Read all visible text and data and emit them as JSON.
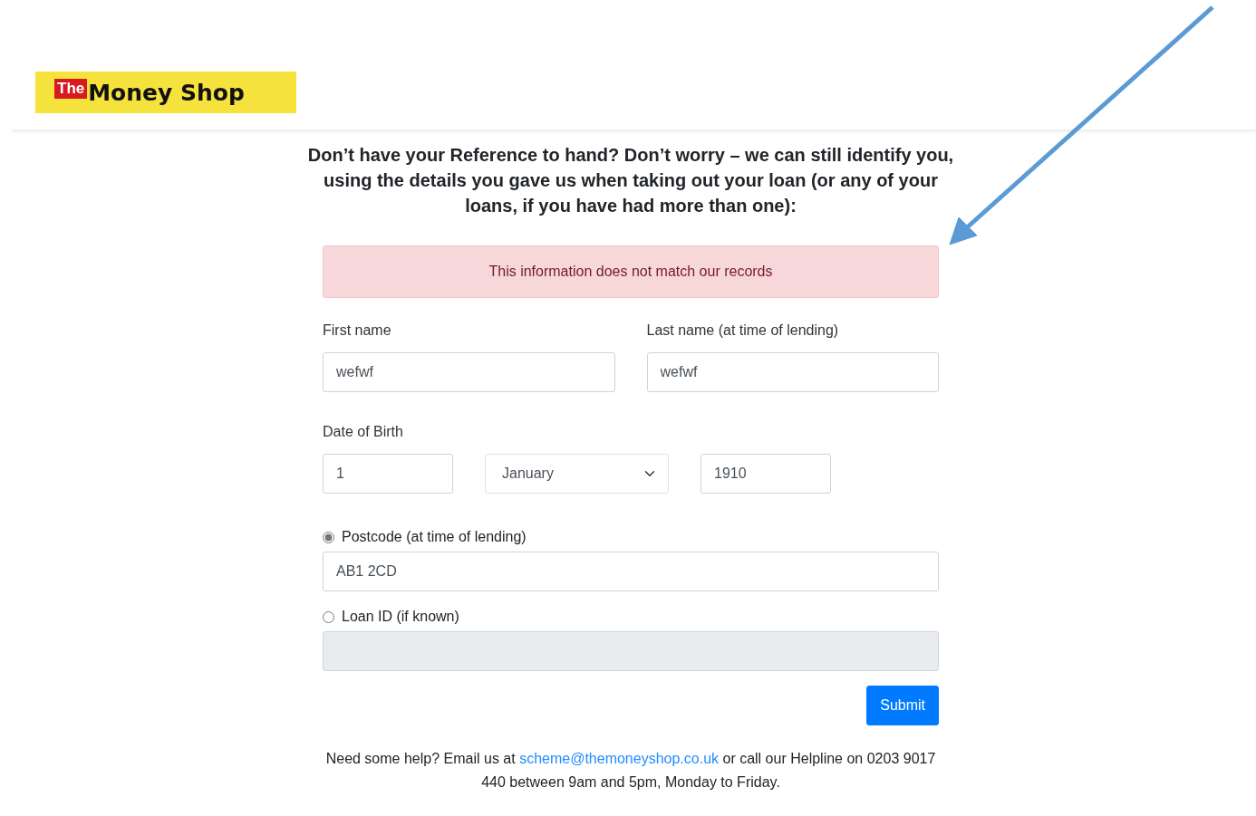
{
  "logo": {
    "badge": "The",
    "name": "Money Shop"
  },
  "heading": "Don’t have your Reference to hand? Don’t worry – we can still identify you, using the details you gave us when taking out your loan (or any of your loans, if you have had more than one):",
  "alert": "This information does not match our records",
  "name_fields": [
    {
      "label": "First name",
      "value": "wefwf"
    },
    {
      "label": "Last name (at time of lending)",
      "value": "wefwf"
    }
  ],
  "dob": {
    "label": "Date of Birth",
    "day": "1",
    "month": "January",
    "year": "1910"
  },
  "id_options": [
    {
      "label": "Postcode (at time of lending)",
      "selected": true,
      "value": "AB1 2CD",
      "disabled": false
    },
    {
      "label": "Loan ID (if known)",
      "selected": false,
      "disabled": true
    }
  ],
  "submit": "Submit",
  "help": {
    "before": "Need some help? Email us at",
    "email": "scheme@themoneyshop.co.uk",
    "after": "or call our Helpline on 0203 9017 440 between 9am and 5pm, Monday to Friday."
  }
}
